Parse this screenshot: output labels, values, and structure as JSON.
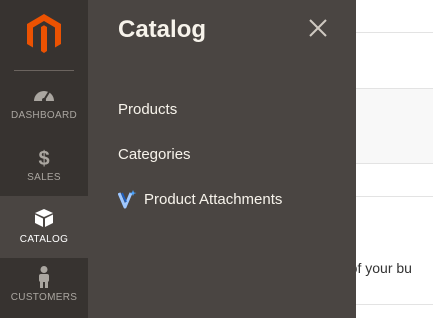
{
  "nav": {
    "items": [
      {
        "label": "DASHBOARD",
        "icon": "speedometer-icon"
      },
      {
        "label": "SALES",
        "icon": "dollar-icon"
      },
      {
        "label": "CATALOG",
        "icon": "cube-icon",
        "active": true
      },
      {
        "label": "CUSTOMERS",
        "icon": "person-icon"
      }
    ]
  },
  "panel": {
    "title": "Catalog",
    "links": [
      "Products",
      "Categories"
    ],
    "attachments_label": "Product Attachments"
  },
  "background": {
    "partial_text": "d of your bu"
  },
  "colors": {
    "brand_orange": "#eb5202",
    "nav_bg": "#373330",
    "panel_bg": "#4a4542",
    "panel_text": "#f7f3eb"
  }
}
